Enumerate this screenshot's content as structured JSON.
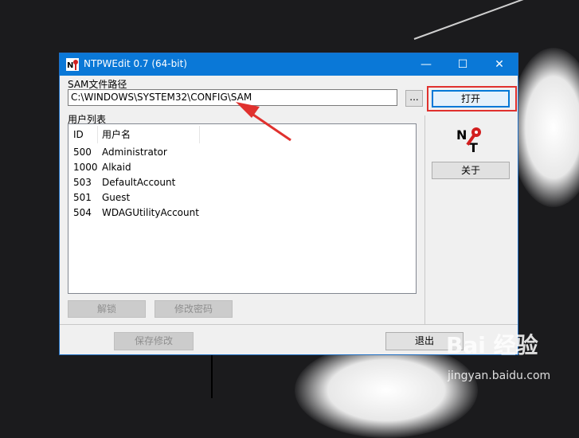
{
  "window": {
    "title": "NTPWEdit 0.7 (64-bit)",
    "controls": {
      "minimize": "—",
      "maximize": "☐",
      "close": "✕"
    }
  },
  "sam": {
    "label": "SAM文件路径",
    "path_value": "C:\\WINDOWS\\SYSTEM32\\CONFIG\\SAM",
    "browse_label": "...",
    "open_label": "打开"
  },
  "users": {
    "label": "用户列表",
    "columns": [
      "ID",
      "用户名"
    ],
    "rows": [
      {
        "id": "500",
        "name": "Administrator"
      },
      {
        "id": "1000",
        "name": "Alkaid"
      },
      {
        "id": "503",
        "name": "DefaultAccount"
      },
      {
        "id": "501",
        "name": "Guest"
      },
      {
        "id": "504",
        "name": "WDAGUtilityAccount"
      }
    ]
  },
  "side": {
    "about_label": "关于"
  },
  "actions": {
    "unlock_label": "解锁",
    "change_password_label": "修改密码",
    "save_label": "保存修改",
    "exit_label": "退出"
  },
  "watermark": {
    "logo": "Bai 经验",
    "url": "jingyan.baidu.com"
  },
  "colors": {
    "titlebar": "#0a78d7",
    "highlight": "#e0312e"
  }
}
